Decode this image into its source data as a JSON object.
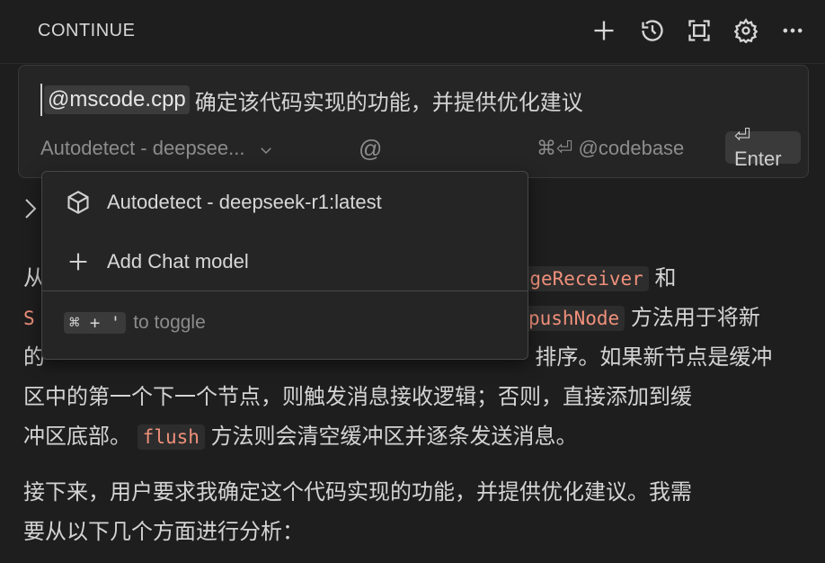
{
  "header": {
    "title": "CONTINUE",
    "icons": [
      "plus-icon",
      "history-icon",
      "fullscreen-icon",
      "gear-icon",
      "more-icon"
    ]
  },
  "input": {
    "mention": "@mscode.cpp",
    "query": "确定该代码实现的功能，并提供优化建议",
    "model_label": "Autodetect - deepsee...",
    "at_label": "@",
    "codebase_hint": "⌘⏎ @codebase",
    "enter_label": "⏎ Enter"
  },
  "dropdown": {
    "items": [
      {
        "icon": "cube-icon",
        "label": "Autodetect - deepseek-r1:latest"
      },
      {
        "icon": "plus-icon",
        "label": "Add Chat model"
      }
    ],
    "shortcut": "⌘ + '",
    "shortcut_text": "to toggle"
  },
  "response": {
    "line1_prefix": "从",
    "line1_code": "geReceiver",
    "line1_suffix": "和",
    "line2_prefix": "S",
    "line2_code": "pushNode",
    "line2_suffix": "方法用于将新",
    "line3_prefix": "的",
    "line3_suffix": "排序。如果新节点是缓冲",
    "line4": "区中的第一个下一个节点，则触发消息接收逻辑；否则，直接添加到缓",
    "line5_prefix": "冲区底部。",
    "line5_code": "flush",
    "line5_suffix": "方法则会清空缓冲区并逐条发送消息。",
    "para2_line1": "接下来，用户要求我确定这个代码实现的功能，并提供优化建议。我需",
    "para2_line2": "要从以下几个方面进行分析："
  }
}
